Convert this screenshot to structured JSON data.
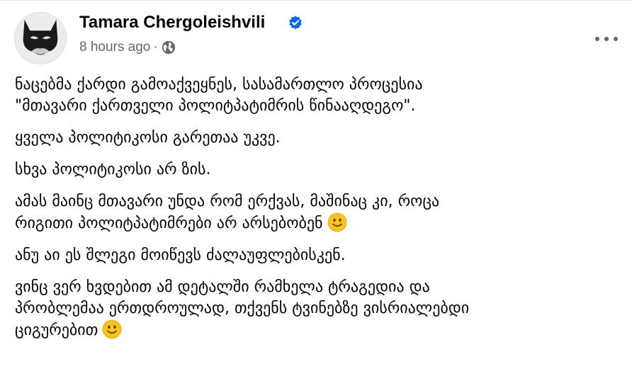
{
  "post": {
    "author": {
      "name": "Tamara Chergoleishvili",
      "verified": true,
      "avatar_icon": "batman-mask-avatar"
    },
    "timestamp": "8 hours ago",
    "separator": "·",
    "audience_icon": "globe-icon",
    "menu_icon": "more-options-icon",
    "paragraphs": [
      {
        "lines": [
          "ნაცებმა ქარდი გამოაქვეყნეს, სასამართლო პროცესია",
          "\"მთავარი ქართველი პოლიტპატიმრის წინააღდეგო\"."
        ],
        "emoji": ""
      },
      {
        "lines": [
          "ყველა პოლიტიკოსი გარეთაა უკვე."
        ],
        "emoji": ""
      },
      {
        "lines": [
          "სხვა პოლიტიკოსი არ ზის."
        ],
        "emoji": ""
      },
      {
        "lines": [
          "ამას მაინც მთავარი უნდა რომ ერქვას, მაშინაც კი, როცა",
          "რიგითი პოლიტპატიმრები არ არსებობენ"
        ],
        "emoji": "smiling-face-emoji"
      },
      {
        "lines": [
          "ანუ აი ეს შლეგი მოიწევს ძალაუფლებისკენ."
        ],
        "emoji": ""
      },
      {
        "lines": [
          "ვინც ვერ ხვდებით ამ დეტალში რამხელა ტრაგედია და",
          "პრობლემაა ერთდროულად, თქვენს ტვინებზე ვისრიალებდი",
          "ციგურებით"
        ],
        "emoji": "smiling-face-emoji"
      }
    ]
  },
  "colors": {
    "text": "#050505",
    "meta": "#65676b",
    "verified_badge": "#0866ff",
    "emoji_face": "#fcc21b"
  }
}
